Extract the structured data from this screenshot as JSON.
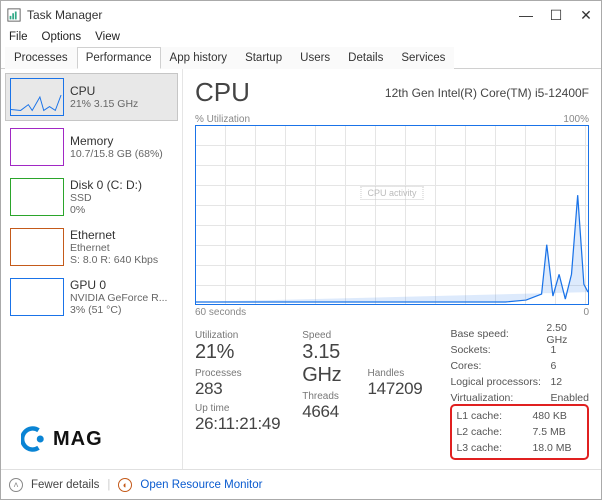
{
  "window_title": "Task Manager",
  "menu": {
    "file": "File",
    "options": "Options",
    "view": "View"
  },
  "tabs": {
    "processes": "Processes",
    "performance": "Performance",
    "app_history": "App history",
    "startup": "Startup",
    "users": "Users",
    "details": "Details",
    "services": "Services"
  },
  "sidebar": [
    {
      "label": "CPU",
      "sub": "21% 3.15 GHz"
    },
    {
      "label": "Memory",
      "sub": "10.7/15.8 GB (68%)"
    },
    {
      "label": "Disk 0 (C: D:)",
      "sub": "SSD\n0%"
    },
    {
      "label": "Ethernet",
      "sub": "Ethernet\nS: 8.0 R: 640 Kbps"
    },
    {
      "label": "GPU 0",
      "sub": "NVIDIA GeForce R...\n3% (51 °C)"
    }
  ],
  "main": {
    "title": "CPU",
    "model": "12th Gen Intel(R) Core(TM) i5-12400F",
    "chart_top_left": "% Utilization",
    "chart_top_right": "100%",
    "chart_bot_left": "60 seconds",
    "chart_bot_right": "0",
    "chart_legend": "CPU activity"
  },
  "stats": {
    "utilization_lbl": "Utilization",
    "utilization": "21%",
    "speed_lbl": "Speed",
    "speed": "3.15 GHz",
    "processes_lbl": "Processes",
    "processes": "283",
    "threads_lbl": "Threads",
    "threads": "4664",
    "handles_lbl": "Handles",
    "handles": "147209",
    "uptime_lbl": "Up time",
    "uptime": "26:11:21:49"
  },
  "props": [
    {
      "k": "Base speed:",
      "v": "2.50 GHz"
    },
    {
      "k": "Sockets:",
      "v": "1"
    },
    {
      "k": "Cores:",
      "v": "6"
    },
    {
      "k": "Logical processors:",
      "v": "12"
    },
    {
      "k": "Virtualization:",
      "v": "Enabled"
    }
  ],
  "cache": [
    {
      "k": "L1 cache:",
      "v": "480 KB"
    },
    {
      "k": "L2 cache:",
      "v": "7.5 MB"
    },
    {
      "k": "L3 cache:",
      "v": "18.0 MB"
    }
  ],
  "footer": {
    "fewer": "Fewer details",
    "orm": "Open Resource Monitor"
  },
  "watermark": {
    "text": "MAG"
  },
  "chart_data": {
    "type": "line",
    "title": "CPU % Utilization",
    "xlabel": "seconds",
    "x_range": [
      60,
      0
    ],
    "ylabel": "% Utilization",
    "ylim": [
      0,
      100
    ],
    "series": [
      {
        "name": "CPU",
        "approx": "mostly 0–5% with spikes to ~35% and ~60% near t=0"
      }
    ]
  }
}
